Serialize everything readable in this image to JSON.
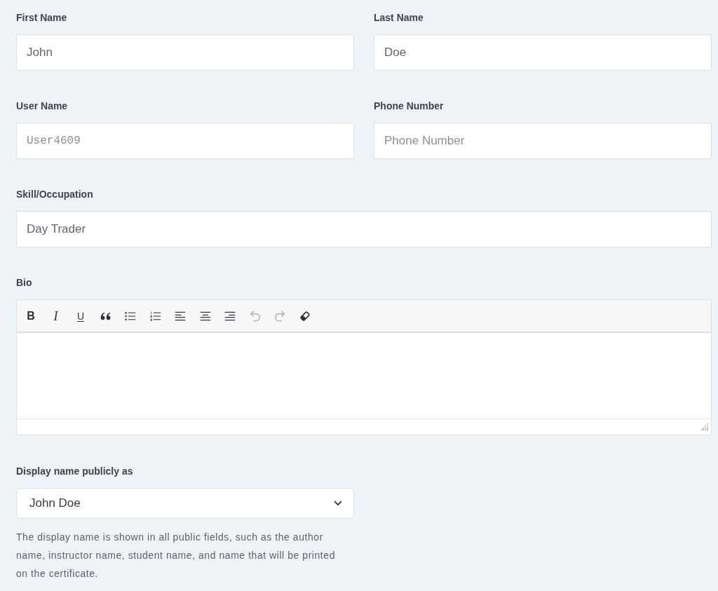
{
  "rows": [
    {
      "fields": [
        {
          "kind": "text",
          "label": "First Name",
          "value": "John",
          "disabled": false
        },
        {
          "kind": "text",
          "label": "Last Name",
          "value": "Doe",
          "disabled": false
        }
      ]
    },
    {
      "fields": [
        {
          "kind": "mono",
          "label": "User Name",
          "value": "User4609",
          "disabled": true
        },
        {
          "kind": "text",
          "label": "Phone Number",
          "placeholder": "Phone Number",
          "disabled": false
        }
      ]
    },
    {
      "fields": [
        {
          "kind": "text",
          "label": "Skill/Occupation",
          "value": "Day Trader",
          "disabled": false
        }
      ]
    }
  ],
  "bio": {
    "label": "Bio",
    "toolbar": [
      {
        "kind": "bold",
        "label": "B",
        "disabled": false
      },
      {
        "kind": "italic",
        "label": "I",
        "disabled": false
      },
      {
        "kind": "underline",
        "label": "U",
        "disabled": false
      },
      {
        "kind": "quote",
        "disabled": false
      },
      {
        "kind": "bullets",
        "disabled": false
      },
      {
        "kind": "numbers",
        "disabled": false
      },
      {
        "kind": "left",
        "disabled": false
      },
      {
        "kind": "center",
        "disabled": false
      },
      {
        "kind": "right",
        "disabled": false
      },
      {
        "kind": "undo",
        "disabled": true
      },
      {
        "kind": "redo",
        "disabled": true
      },
      {
        "kind": "eraser",
        "disabled": false
      }
    ]
  },
  "display_name": {
    "label": "Display name publicly as",
    "value": "John Doe",
    "help": "The display name is shown in all public fields, such as the author name, instructor name, student name, and name that will be printed on the certificate."
  }
}
